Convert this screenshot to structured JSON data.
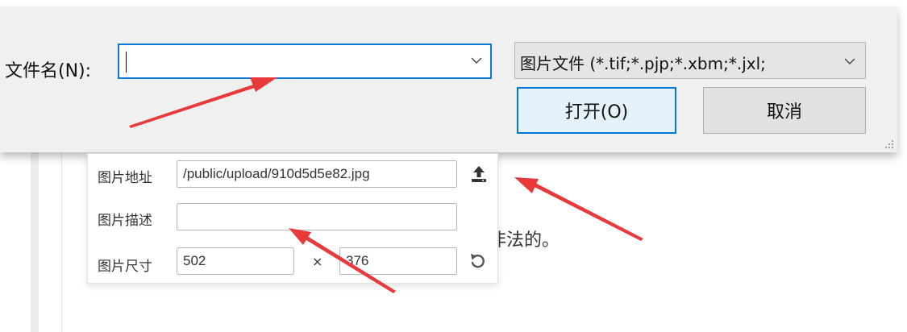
{
  "file_dialog": {
    "filename_label": "文件名(N):",
    "filename_value": "",
    "filetype_filter": "图片文件 (*.tif;*.pjp;*.xbm;*.jxl;",
    "open_button": "打开(O)",
    "cancel_button": "取消"
  },
  "image_props": {
    "address_label": "图片地址",
    "address_value": "/public/upload/910d5d5e82.jpg",
    "desc_label": "图片描述",
    "desc_value": "",
    "size_label": "图片尺寸",
    "width_value": "502",
    "times": "×",
    "height_value": "376"
  },
  "background": {
    "text_fragment": "非法的。"
  },
  "icons": [
    "chevron-down-icon",
    "upload-icon",
    "reset-icon",
    "resize-grip-icon"
  ],
  "colors": {
    "arrow": "#e8393b",
    "focus_border": "#0a78d7",
    "dialog_bg": "#f0f0f0"
  }
}
